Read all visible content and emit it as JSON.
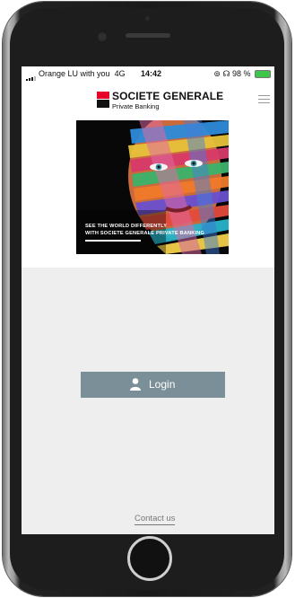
{
  "status_bar": {
    "carrier": "Orange LU with you",
    "network": "4G",
    "time": "14:42",
    "battery": "98 %",
    "icons": [
      "signal-icon",
      "alarm-icon",
      "headphones-icon",
      "battery-icon"
    ]
  },
  "header": {
    "brand": "SOCIETE GENERALE",
    "subtitle": "Private Banking",
    "brand_color": "#e60028"
  },
  "hero": {
    "line1": "SEE THE WORLD DIFFERENTLY",
    "line2": "WITH SOCIETE GENERALE PRIVATE BANKING"
  },
  "login": {
    "label": "Login",
    "color": "#7b8f99",
    "icon": "user-icon"
  },
  "footer": {
    "contact": "Contact us"
  }
}
